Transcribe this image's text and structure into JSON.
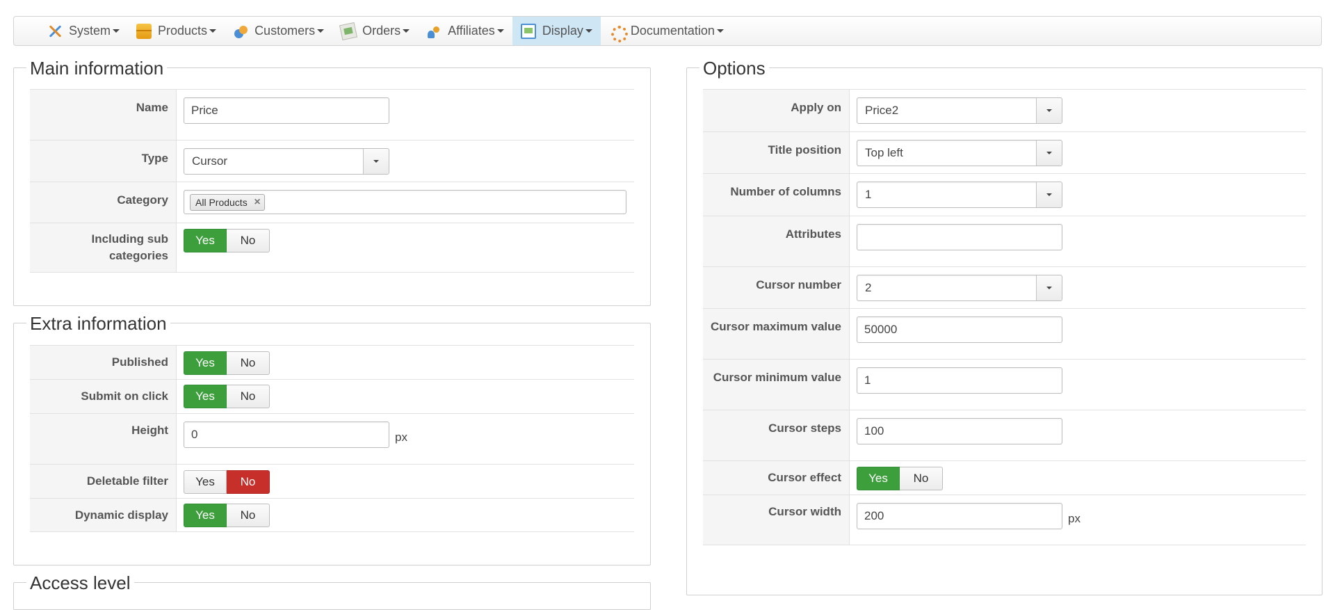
{
  "nav": {
    "items": [
      {
        "label": "System",
        "icon": "tools-icon"
      },
      {
        "label": "Products",
        "icon": "box-icon"
      },
      {
        "label": "Customers",
        "icon": "users-icon"
      },
      {
        "label": "Orders",
        "icon": "orders-icon"
      },
      {
        "label": "Affiliates",
        "icon": "affiliates-icon"
      },
      {
        "label": "Display",
        "icon": "display-icon",
        "active": true
      },
      {
        "label": "Documentation",
        "icon": "lifebuoy-icon"
      }
    ]
  },
  "main": {
    "legend": "Main information",
    "name_label": "Name",
    "name_value": "Price",
    "type_label": "Type",
    "type_value": "Cursor",
    "category_label": "Category",
    "category_tag": "All Products",
    "subcat_label": "Including sub categories",
    "yes": "Yes",
    "no": "No"
  },
  "extra": {
    "legend": "Extra information",
    "published_label": "Published",
    "submit_label": "Submit on click",
    "height_label": "Height",
    "height_value": "0",
    "height_unit": "px",
    "deletable_label": "Deletable filter",
    "dynamic_label": "Dynamic display",
    "yes": "Yes",
    "no": "No"
  },
  "access": {
    "legend": "Access level"
  },
  "options": {
    "legend": "Options",
    "apply_label": "Apply on",
    "apply_value": "Price2",
    "title_pos_label": "Title position",
    "title_pos_value": "Top left",
    "columns_label": "Number of columns",
    "columns_value": "1",
    "attributes_label": "Attributes",
    "attributes_value": "",
    "cursor_number_label": "Cursor number",
    "cursor_number_value": "2",
    "cursor_max_label": "Cursor maximum value",
    "cursor_max_value": "50000",
    "cursor_min_label": "Cursor minimum value",
    "cursor_min_value": "1",
    "cursor_steps_label": "Cursor steps",
    "cursor_steps_value": "100",
    "cursor_effect_label": "Cursor effect",
    "cursor_width_label": "Cursor width",
    "cursor_width_value": "200",
    "cursor_width_unit": "px",
    "yes": "Yes",
    "no": "No"
  },
  "colors": {
    "yes_active": "#3c9f3c",
    "no_active": "#c62f2a",
    "nav_active": "#cfe6f5"
  }
}
